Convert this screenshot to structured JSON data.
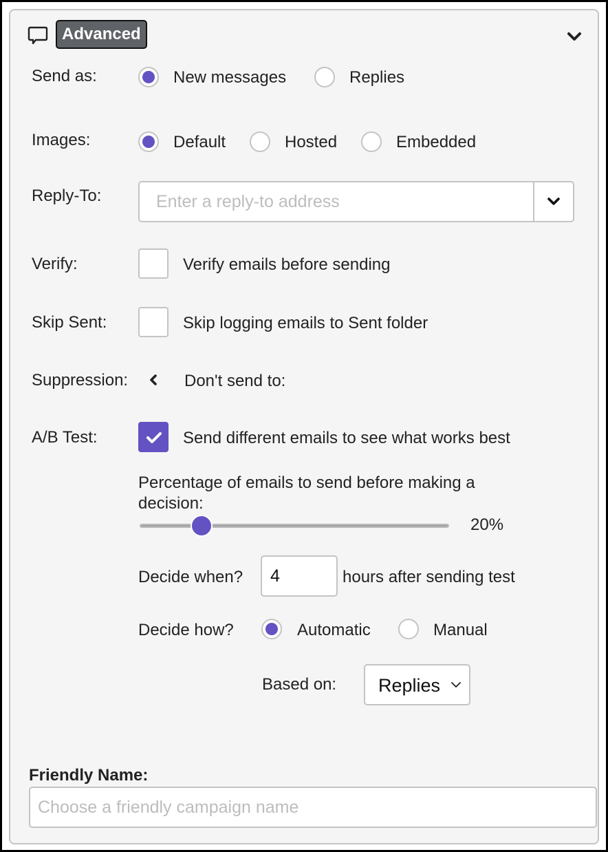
{
  "header": {
    "icon": "speech-bubble-icon",
    "badge_label": "Advanced",
    "collapse_icon": "chevron-down-icon"
  },
  "send_as": {
    "label": "Send as:",
    "options": [
      {
        "label": "New messages",
        "checked": true
      },
      {
        "label": "Replies",
        "checked": false
      }
    ]
  },
  "images": {
    "label": "Images:",
    "options": [
      {
        "label": "Default",
        "checked": true
      },
      {
        "label": "Hosted",
        "checked": false
      },
      {
        "label": "Embedded",
        "checked": false
      }
    ]
  },
  "reply_to": {
    "label": "Reply-To:",
    "value": "",
    "placeholder": "Enter a reply-to address",
    "dropdown_icon": "chevron-down-icon"
  },
  "verify": {
    "label": "Verify:",
    "checked": false,
    "text": "Verify emails before sending"
  },
  "skip_sent": {
    "label": "Skip Sent:",
    "checked": false,
    "text": "Skip logging emails to Sent folder"
  },
  "suppression": {
    "label": "Suppression:",
    "toggle_icon": "chevron-left-icon",
    "text": "Don't send to:"
  },
  "ab_test": {
    "label": "A/B Test:",
    "checked": true,
    "text": "Send different emails to see what works best",
    "percentage_label": "Percentage of emails to send before making a decision:",
    "percentage_value": 20,
    "percentage_display": "20%",
    "decide_when_label": "Decide when?",
    "decide_when_value": "4",
    "decide_when_suffix": "hours after sending test",
    "decide_how_label": "Decide how?",
    "decide_how_options": [
      {
        "label": "Automatic",
        "checked": true
      },
      {
        "label": "Manual",
        "checked": false
      }
    ],
    "based_on_label": "Based on:",
    "based_on_value": "Replies"
  },
  "friendly_name": {
    "label": "Friendly Name:",
    "value": "",
    "placeholder": "Choose a friendly campaign name"
  },
  "colors": {
    "accent": "#6352c2",
    "badge_bg": "#5f6266",
    "panel_bg": "#f5f5f5",
    "border": "#c4c4c4"
  }
}
